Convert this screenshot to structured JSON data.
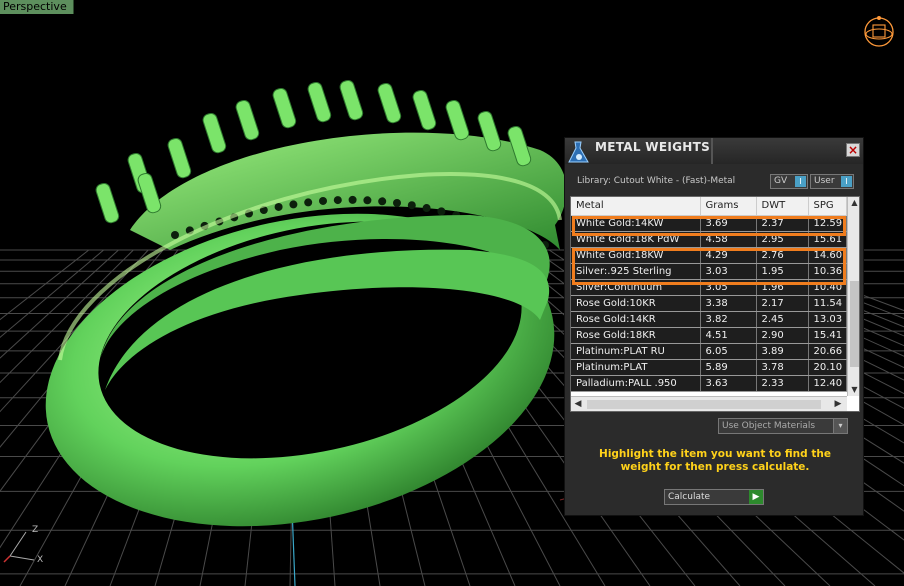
{
  "viewport": {
    "label": "Perspective"
  },
  "colors": {
    "model": "#6fe36f",
    "grid": "#4a4a4a",
    "highlight": "#f07d1e",
    "instruction_text": "#ffd21a"
  },
  "panel": {
    "title": "METAL WEIGHTS",
    "close_glyph": "×",
    "library": "Library: Cutout White - (Fast)-Metal",
    "toggle_gv": "GV",
    "toggle_user": "User",
    "toggle_glyph": "I",
    "columns": [
      "Metal",
      "Grams",
      "DWT",
      "SPG"
    ],
    "rows": [
      [
        "White Gold:14KW",
        "3.69",
        "2.37",
        "12.59"
      ],
      [
        "White Gold:18K PdW",
        "4.58",
        "2.95",
        "15.61"
      ],
      [
        "White Gold:18KW",
        "4.29",
        "2.76",
        "14.60"
      ],
      [
        "Silver:.925 Sterling",
        "3.03",
        "1.95",
        "10.36"
      ],
      [
        "Silver:Continuum",
        "3.05",
        "1.96",
        "10.40"
      ],
      [
        "Rose Gold:10KR",
        "3.38",
        "2.17",
        "11.54"
      ],
      [
        "Rose Gold:14KR",
        "3.82",
        "2.45",
        "13.03"
      ],
      [
        "Rose Gold:18KR",
        "4.51",
        "2.90",
        "15.41"
      ],
      [
        "Platinum:PLAT RU",
        "6.05",
        "3.89",
        "20.66"
      ],
      [
        "Platinum:PLAT",
        "5.89",
        "3.78",
        "20.10"
      ],
      [
        "Palladium:PALL .950",
        "3.63",
        "2.33",
        "12.40"
      ]
    ],
    "use_object_materials": "Use Object Materials",
    "instructions": "Highlight the item you want to find the weight for then press calculate.",
    "calculate": "Calculate",
    "scroll_up": "▲",
    "scroll_down": "▼",
    "scroll_left": "◀",
    "scroll_right": "▶",
    "dropdown_glyph": "▾",
    "go_glyph": "▶"
  },
  "triad": {
    "x": "X",
    "z": "Z"
  },
  "icons": {
    "logo": "flask-logo-icon",
    "gizmo": "view-gizmo-icon",
    "close": "close-icon"
  }
}
